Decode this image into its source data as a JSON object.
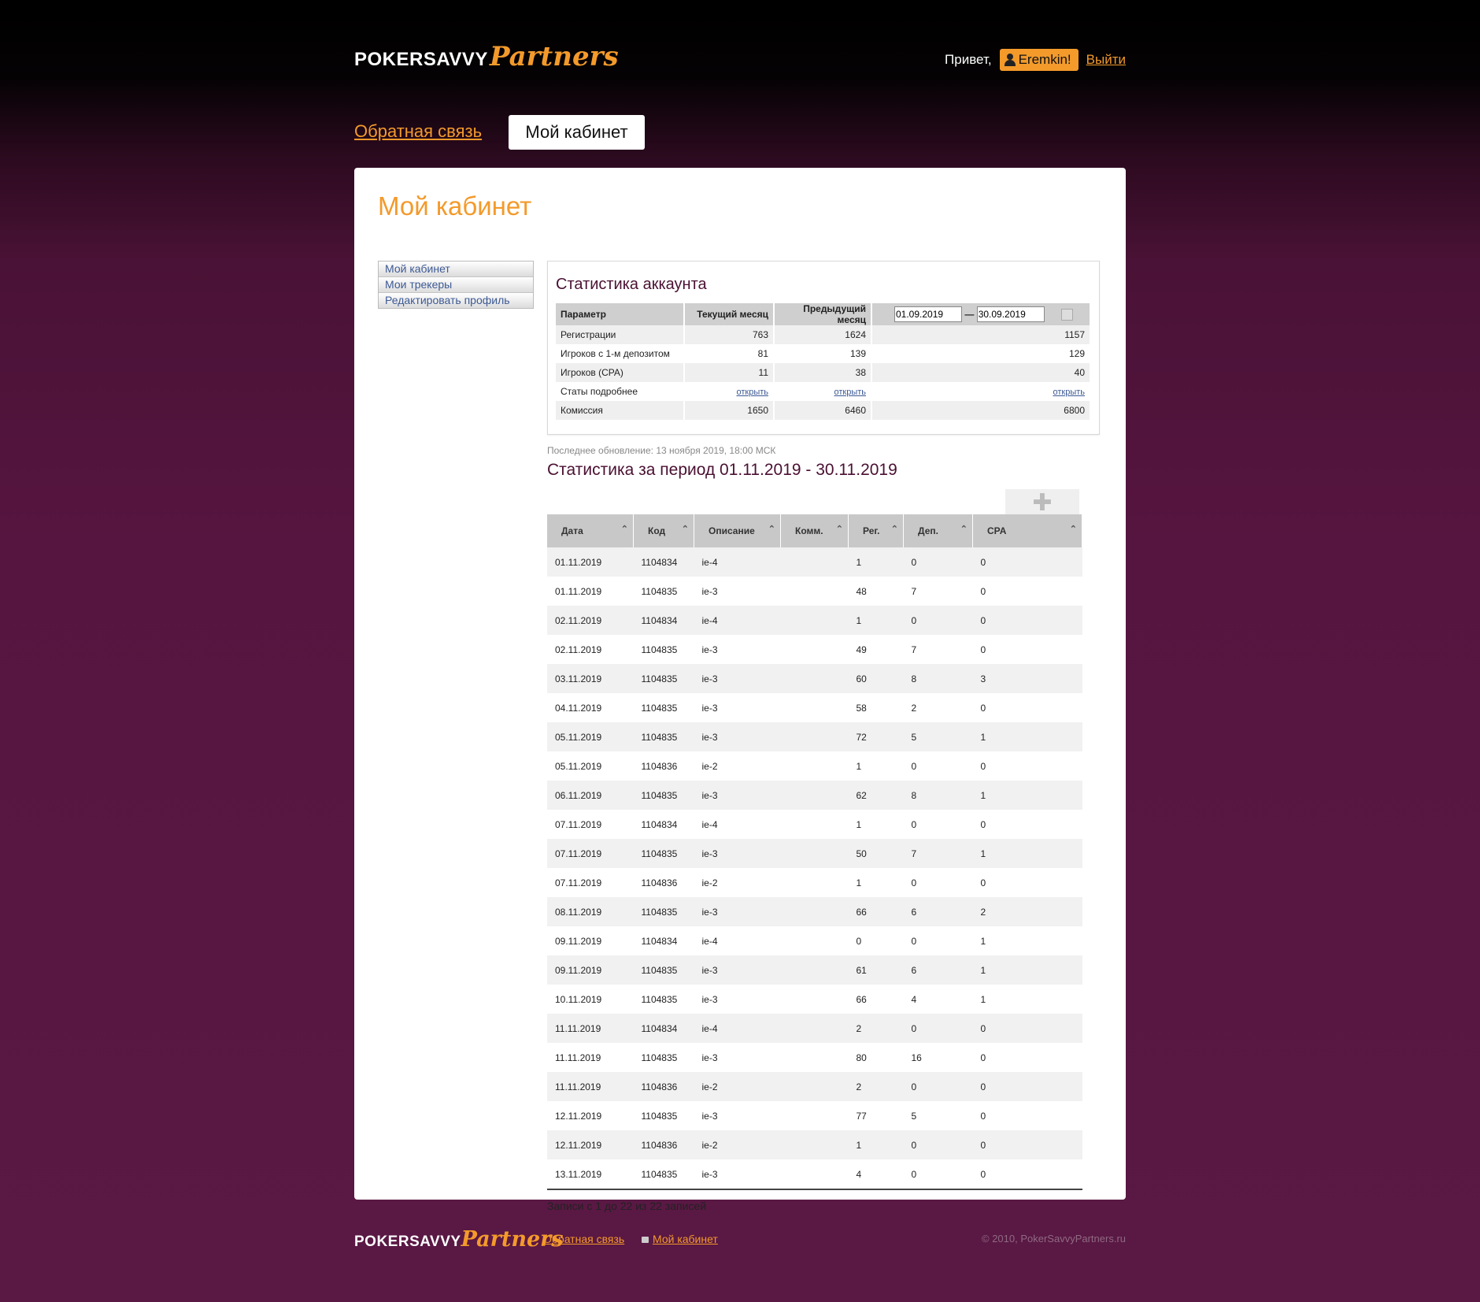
{
  "header": {
    "logo_brand": "POKERSAVVY",
    "logo_script": "Partners",
    "greeting": "Привет,",
    "username": "Eremkin!",
    "logout": "Выйти"
  },
  "nav": {
    "feedback": "Обратная связь",
    "cabinet": "Мой кабинет"
  },
  "page_title": "Мой кабинет",
  "sidebar": {
    "items": [
      "Мой кабинет",
      "Мои трекеры",
      "Редактировать профиль"
    ]
  },
  "account_stats": {
    "title": "Статистика аккаунта",
    "headers": [
      "Параметр",
      "Текущий месяц",
      "Предыдущий месяц"
    ],
    "date_from": "01.09.2019",
    "date_sep": "—",
    "date_to": "30.09.2019",
    "rows": [
      {
        "param": "Регистрации",
        "current": "763",
        "previous": "1624",
        "custom": "1157"
      },
      {
        "param": "Игроков с 1-м депозитом",
        "current": "81",
        "previous": "139",
        "custom": "129"
      },
      {
        "param": "Игроков (CPA)",
        "current": "11",
        "previous": "38",
        "custom": "40"
      },
      {
        "param": "Статы подробнее",
        "current": "открыть",
        "previous": "открыть",
        "custom": "открыть"
      },
      {
        "param": "Комиссия",
        "current": "1650",
        "previous": "6460",
        "custom": "6800"
      }
    ]
  },
  "last_update": "Последнее обновление: 13 ноября 2019, 18:00 МСК",
  "period_title": "Статистика за период 01.11.2019 - 30.11.2019",
  "table": {
    "headers": [
      "Дата",
      "Код",
      "Описание",
      "Комм.",
      "Рег.",
      "Деп.",
      "CPA"
    ],
    "rows": [
      [
        "01.11.2019",
        "1104834",
        "ie-4",
        "",
        "1",
        "0",
        "0"
      ],
      [
        "01.11.2019",
        "1104835",
        "ie-3",
        "",
        "48",
        "7",
        "0"
      ],
      [
        "02.11.2019",
        "1104834",
        "ie-4",
        "",
        "1",
        "0",
        "0"
      ],
      [
        "02.11.2019",
        "1104835",
        "ie-3",
        "",
        "49",
        "7",
        "0"
      ],
      [
        "03.11.2019",
        "1104835",
        "ie-3",
        "",
        "60",
        "8",
        "3"
      ],
      [
        "04.11.2019",
        "1104835",
        "ie-3",
        "",
        "58",
        "2",
        "0"
      ],
      [
        "05.11.2019",
        "1104835",
        "ie-3",
        "",
        "72",
        "5",
        "1"
      ],
      [
        "05.11.2019",
        "1104836",
        "ie-2",
        "",
        "1",
        "0",
        "0"
      ],
      [
        "06.11.2019",
        "1104835",
        "ie-3",
        "",
        "62",
        "8",
        "1"
      ],
      [
        "07.11.2019",
        "1104834",
        "ie-4",
        "",
        "1",
        "0",
        "0"
      ],
      [
        "07.11.2019",
        "1104835",
        "ie-3",
        "",
        "50",
        "7",
        "1"
      ],
      [
        "07.11.2019",
        "1104836",
        "ie-2",
        "",
        "1",
        "0",
        "0"
      ],
      [
        "08.11.2019",
        "1104835",
        "ie-3",
        "",
        "66",
        "6",
        "2"
      ],
      [
        "09.11.2019",
        "1104834",
        "ie-4",
        "",
        "0",
        "0",
        "1"
      ],
      [
        "09.11.2019",
        "1104835",
        "ie-3",
        "",
        "61",
        "6",
        "1"
      ],
      [
        "10.11.2019",
        "1104835",
        "ie-3",
        "",
        "66",
        "4",
        "1"
      ],
      [
        "11.11.2019",
        "1104834",
        "ie-4",
        "",
        "2",
        "0",
        "0"
      ],
      [
        "11.11.2019",
        "1104835",
        "ie-3",
        "",
        "80",
        "16",
        "0"
      ],
      [
        "11.11.2019",
        "1104836",
        "ie-2",
        "",
        "2",
        "0",
        "0"
      ],
      [
        "12.11.2019",
        "1104835",
        "ie-3",
        "",
        "77",
        "5",
        "0"
      ],
      [
        "12.11.2019",
        "1104836",
        "ie-2",
        "",
        "1",
        "0",
        "0"
      ],
      [
        "13.11.2019",
        "1104835",
        "ie-3",
        "",
        "4",
        "0",
        "0"
      ]
    ],
    "records_info": "Записи с 1 до 22 из 22 записей"
  },
  "footer": {
    "logo_brand": "POKERSAVVY",
    "logo_script": "Partners",
    "feedback": "Обратная связь",
    "cabinet": "Мой кабинет",
    "copyright": "© 2010, PokerSavvyPartners.ru"
  },
  "colors": {
    "accent": "#f39a2b",
    "title": "#4a1032",
    "link": "#3d5a94"
  }
}
